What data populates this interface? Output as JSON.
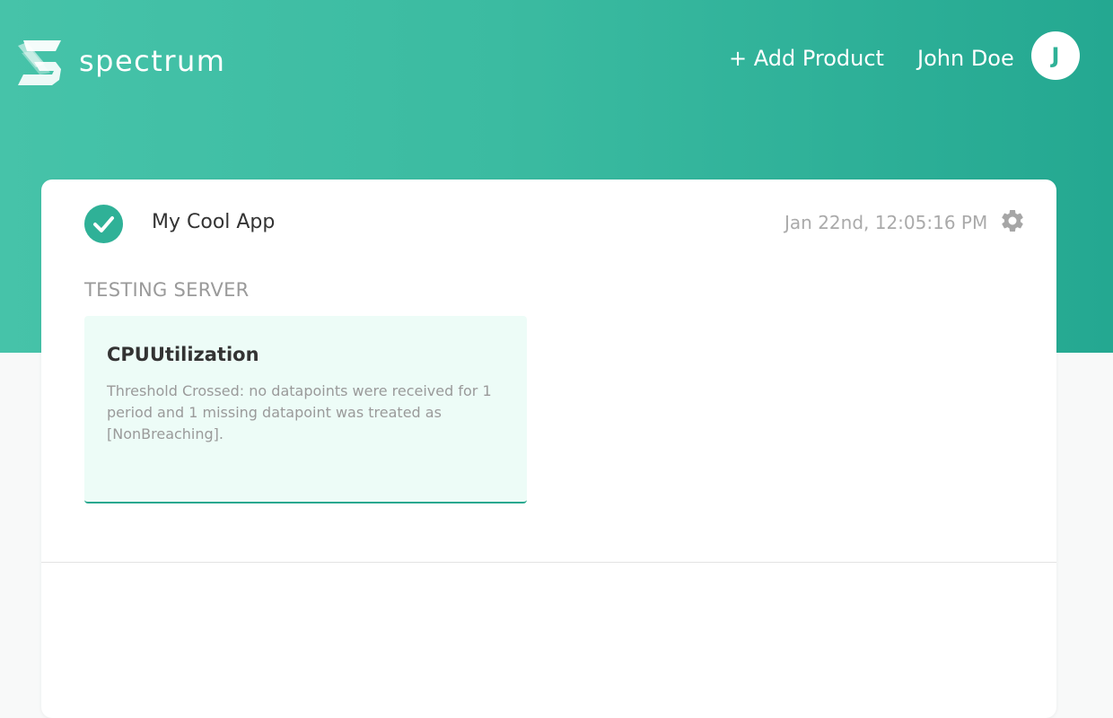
{
  "header": {
    "brand": "spectrum",
    "add_product_label": "+ Add Product",
    "user_name": "John Doe",
    "avatar_initial": "J"
  },
  "product": {
    "name": "My Cool App",
    "status": "ok",
    "timestamp": "Jan 22nd, 12:05:16 PM",
    "section_title": "TESTING SERVER",
    "alarms": [
      {
        "title": "CPUUtilization",
        "description": "Threshold Crossed: no datapoints were received for 1 period and 1 missing datapoint was treated as [NonBreaching]."
      }
    ]
  },
  "colors": {
    "brand_teal": "#3bbba1",
    "brand_teal_dark": "#24a891",
    "alarm_bg": "#edfcf7"
  },
  "icons": {
    "logo": "spectrum-logo-icon",
    "status": "check-circle-icon",
    "settings": "gear-icon"
  }
}
